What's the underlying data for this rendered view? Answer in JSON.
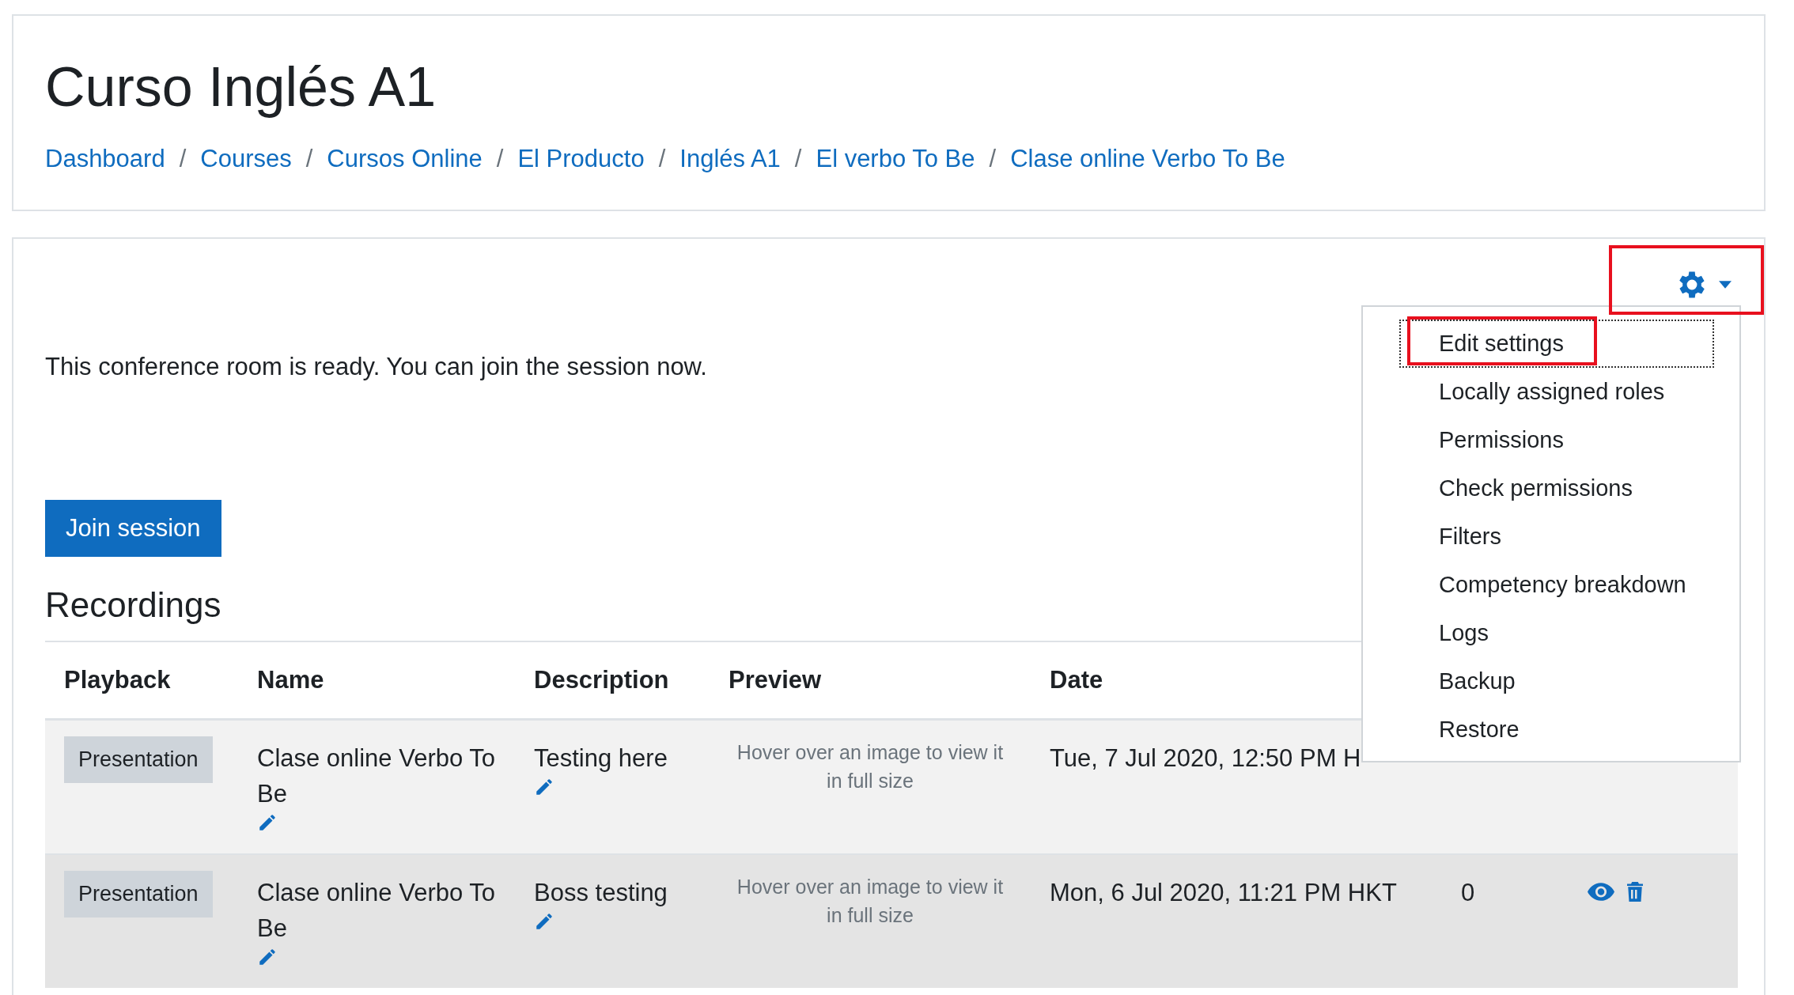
{
  "header": {
    "title": "Curso Inglés A1",
    "breadcrumbs": [
      "Dashboard",
      "Courses",
      "Cursos Online",
      "El Producto",
      "Inglés A1",
      "El verbo To Be",
      "Clase online Verbo To Be"
    ],
    "separator": "/"
  },
  "status_message": "This conference room is ready. You can join the session now.",
  "join_button": "Join session",
  "recordings": {
    "title": "Recordings",
    "columns": [
      "Playback",
      "Name",
      "Description",
      "Preview",
      "Date"
    ],
    "rows": [
      {
        "playback": "Presentation",
        "name": "Clase online Verbo To Be",
        "description": "Testing here",
        "preview": "Hover over an image to view it in full size",
        "date": "Tue, 7 Jul 2020, 12:50 PM H",
        "hovered": false
      },
      {
        "playback": "Presentation",
        "name": "Clase online Verbo To Be",
        "description": "Boss testing",
        "preview": "Hover over an image to view it in full size",
        "date": "Mon, 6 Jul 2020, 11:21 PM HKT",
        "count": "0",
        "actions": true,
        "hovered": true
      }
    ]
  },
  "settings_menu": {
    "expanded": true,
    "items": [
      {
        "label": "Edit settings",
        "focused": true,
        "highlighted": true
      },
      {
        "label": "Locally assigned roles",
        "focused": false,
        "highlighted": false
      },
      {
        "label": "Permissions",
        "focused": false,
        "highlighted": false
      },
      {
        "label": "Check permissions",
        "focused": false,
        "highlighted": false
      },
      {
        "label": "Filters",
        "focused": false,
        "highlighted": false
      },
      {
        "label": "Competency breakdown",
        "focused": false,
        "highlighted": false
      },
      {
        "label": "Logs",
        "focused": false,
        "highlighted": false
      },
      {
        "label": "Backup",
        "focused": false,
        "highlighted": false
      },
      {
        "label": "Restore",
        "focused": false,
        "highlighted": false
      }
    ]
  }
}
